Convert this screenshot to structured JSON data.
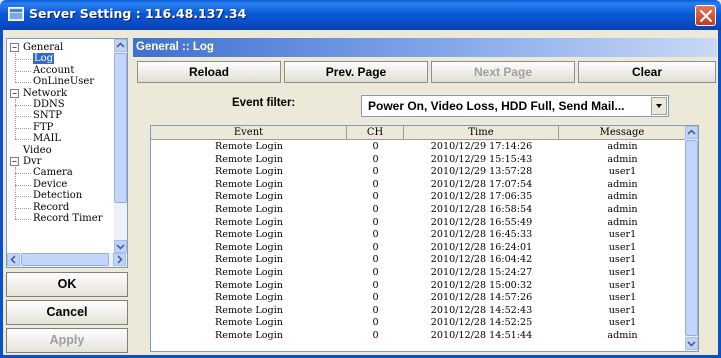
{
  "window": {
    "title": "Server Setting : 116.48.137.34"
  },
  "tree": {
    "items": [
      {
        "label": "General",
        "level": 0,
        "toggle": "−"
      },
      {
        "label": "Log",
        "level": 1,
        "selected": true
      },
      {
        "label": "Account",
        "level": 1
      },
      {
        "label": "OnLineUser",
        "level": 1
      },
      {
        "label": "Network",
        "level": 0,
        "toggle": "−"
      },
      {
        "label": "DDNS",
        "level": 1
      },
      {
        "label": "SNTP",
        "level": 1
      },
      {
        "label": "FTP",
        "level": 1
      },
      {
        "label": "MAIL",
        "level": 1
      },
      {
        "label": "Video",
        "level": 0
      },
      {
        "label": "Dvr",
        "level": 0,
        "toggle": "−"
      },
      {
        "label": "Camera",
        "level": 1
      },
      {
        "label": "Device",
        "level": 1
      },
      {
        "label": "Detection",
        "level": 1
      },
      {
        "label": "Record",
        "level": 1
      },
      {
        "label": "Record Timer",
        "level": 1
      }
    ]
  },
  "buttons": {
    "ok": "OK",
    "cancel": "Cancel",
    "apply": "Apply"
  },
  "section": {
    "header": "General :: Log"
  },
  "toolbar": {
    "reload": "Reload",
    "prev": "Prev. Page",
    "next": "Next Page",
    "clear": "Clear"
  },
  "filter": {
    "label": "Event filter:",
    "value": "Power On, Video Loss, HDD Full, Send Mail..."
  },
  "log": {
    "columns": [
      "Event",
      "CH",
      "Time",
      "Message"
    ],
    "rows": [
      [
        "Remote Login",
        "0",
        "2010/12/29 17:14:26",
        "admin"
      ],
      [
        "Remote Login",
        "0",
        "2010/12/29 15:15:43",
        "admin"
      ],
      [
        "Remote Login",
        "0",
        "2010/12/29 13:57:28",
        "user1"
      ],
      [
        "Remote Login",
        "0",
        "2010/12/28 17:07:54",
        "admin"
      ],
      [
        "Remote Login",
        "0",
        "2010/12/28 17:06:35",
        "admin"
      ],
      [
        "Remote Login",
        "0",
        "2010/12/28 16:58:54",
        "admin"
      ],
      [
        "Remote Login",
        "0",
        "2010/12/28 16:55:49",
        "admin"
      ],
      [
        "Remote Login",
        "0",
        "2010/12/28 16:45:33",
        "user1"
      ],
      [
        "Remote Login",
        "0",
        "2010/12/28 16:24:01",
        "user1"
      ],
      [
        "Remote Login",
        "0",
        "2010/12/28 16:04:42",
        "user1"
      ],
      [
        "Remote Login",
        "0",
        "2010/12/28 15:24:27",
        "user1"
      ],
      [
        "Remote Login",
        "0",
        "2010/12/28 15:00:32",
        "user1"
      ],
      [
        "Remote Login",
        "0",
        "2010/12/28 14:57:26",
        "user1"
      ],
      [
        "Remote Login",
        "0",
        "2010/12/28 14:52:43",
        "user1"
      ],
      [
        "Remote Login",
        "0",
        "2010/12/28 14:52:25",
        "user1"
      ],
      [
        "Remote Login",
        "0",
        "2010/12/28 14:51:44",
        "admin"
      ]
    ]
  },
  "colors": {
    "titlebar": "#0a5fd8",
    "selection": "#316ac5",
    "header_text": "#ffffcc"
  },
  "icons": {
    "app": "server-setting-icon",
    "close": "close-icon",
    "dropdown": "chevron-down-icon"
  }
}
